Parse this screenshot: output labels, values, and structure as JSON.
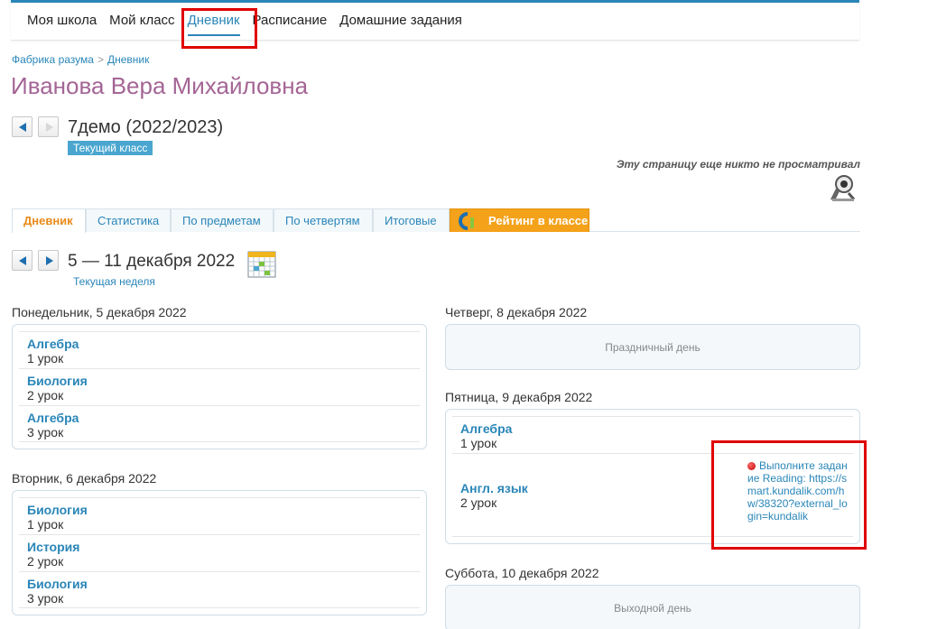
{
  "nav": {
    "items": [
      {
        "label": "Моя школа"
      },
      {
        "label": "Мой класс"
      },
      {
        "label": "Дневник"
      },
      {
        "label": "Расписание"
      },
      {
        "label": "Домашние задания"
      }
    ],
    "active_index": 2
  },
  "breadcrumb": {
    "root": "Фабрика разума",
    "separator": ">",
    "current": "Дневник"
  },
  "page_title": "Иванова Вера Михайловна",
  "class_info": {
    "name": "7демо (2022/2023)",
    "badge": "Текущий класс"
  },
  "views_note": "Эту страницу еще никто не просматривал",
  "tabs": [
    {
      "label": "Дневник"
    },
    {
      "label": "Статистика"
    },
    {
      "label": "По предметам"
    },
    {
      "label": "По четвертям"
    },
    {
      "label": "Итоговые"
    },
    {
      "label": "Рейтинг в классе"
    }
  ],
  "week": {
    "title": "5 — 11 декабря 2022",
    "link": "Текущая неделя"
  },
  "days": {
    "mon": {
      "title": "Понедельник, 5 декабря 2022",
      "lessons": [
        {
          "subject": "Алгебра",
          "number": "1 урок"
        },
        {
          "subject": "Биология",
          "number": "2 урок"
        },
        {
          "subject": "Алгебра",
          "number": "3 урок"
        }
      ]
    },
    "tue": {
      "title": "Вторник, 6 декабря 2022",
      "lessons": [
        {
          "subject": "Биология",
          "number": "1 урок"
        },
        {
          "subject": "История",
          "number": "2 урок"
        },
        {
          "subject": "Биология",
          "number": "3 урок"
        }
      ]
    },
    "thu": {
      "title": "Четверг, 8 декабря 2022",
      "empty_text": "Праздничный день"
    },
    "fri": {
      "title": "Пятница, 9 декабря 2022",
      "lessons": [
        {
          "subject": "Алгебра",
          "number": "1 урок"
        },
        {
          "subject": "Англ. язык",
          "number": "2 урок",
          "homework": "Выполните задание Reading: https://smart.kundalik.com/hw/38320?external_login=kundalik"
        }
      ]
    },
    "sat": {
      "title": "Суббота, 10 декабря 2022",
      "empty_text": "Выходной день"
    }
  },
  "colors": {
    "accent": "#2a86b8",
    "title": "#a46595",
    "active_tab": "#e98b1a",
    "rating_tab": "#f4a21a",
    "highlight": "#e00000"
  }
}
